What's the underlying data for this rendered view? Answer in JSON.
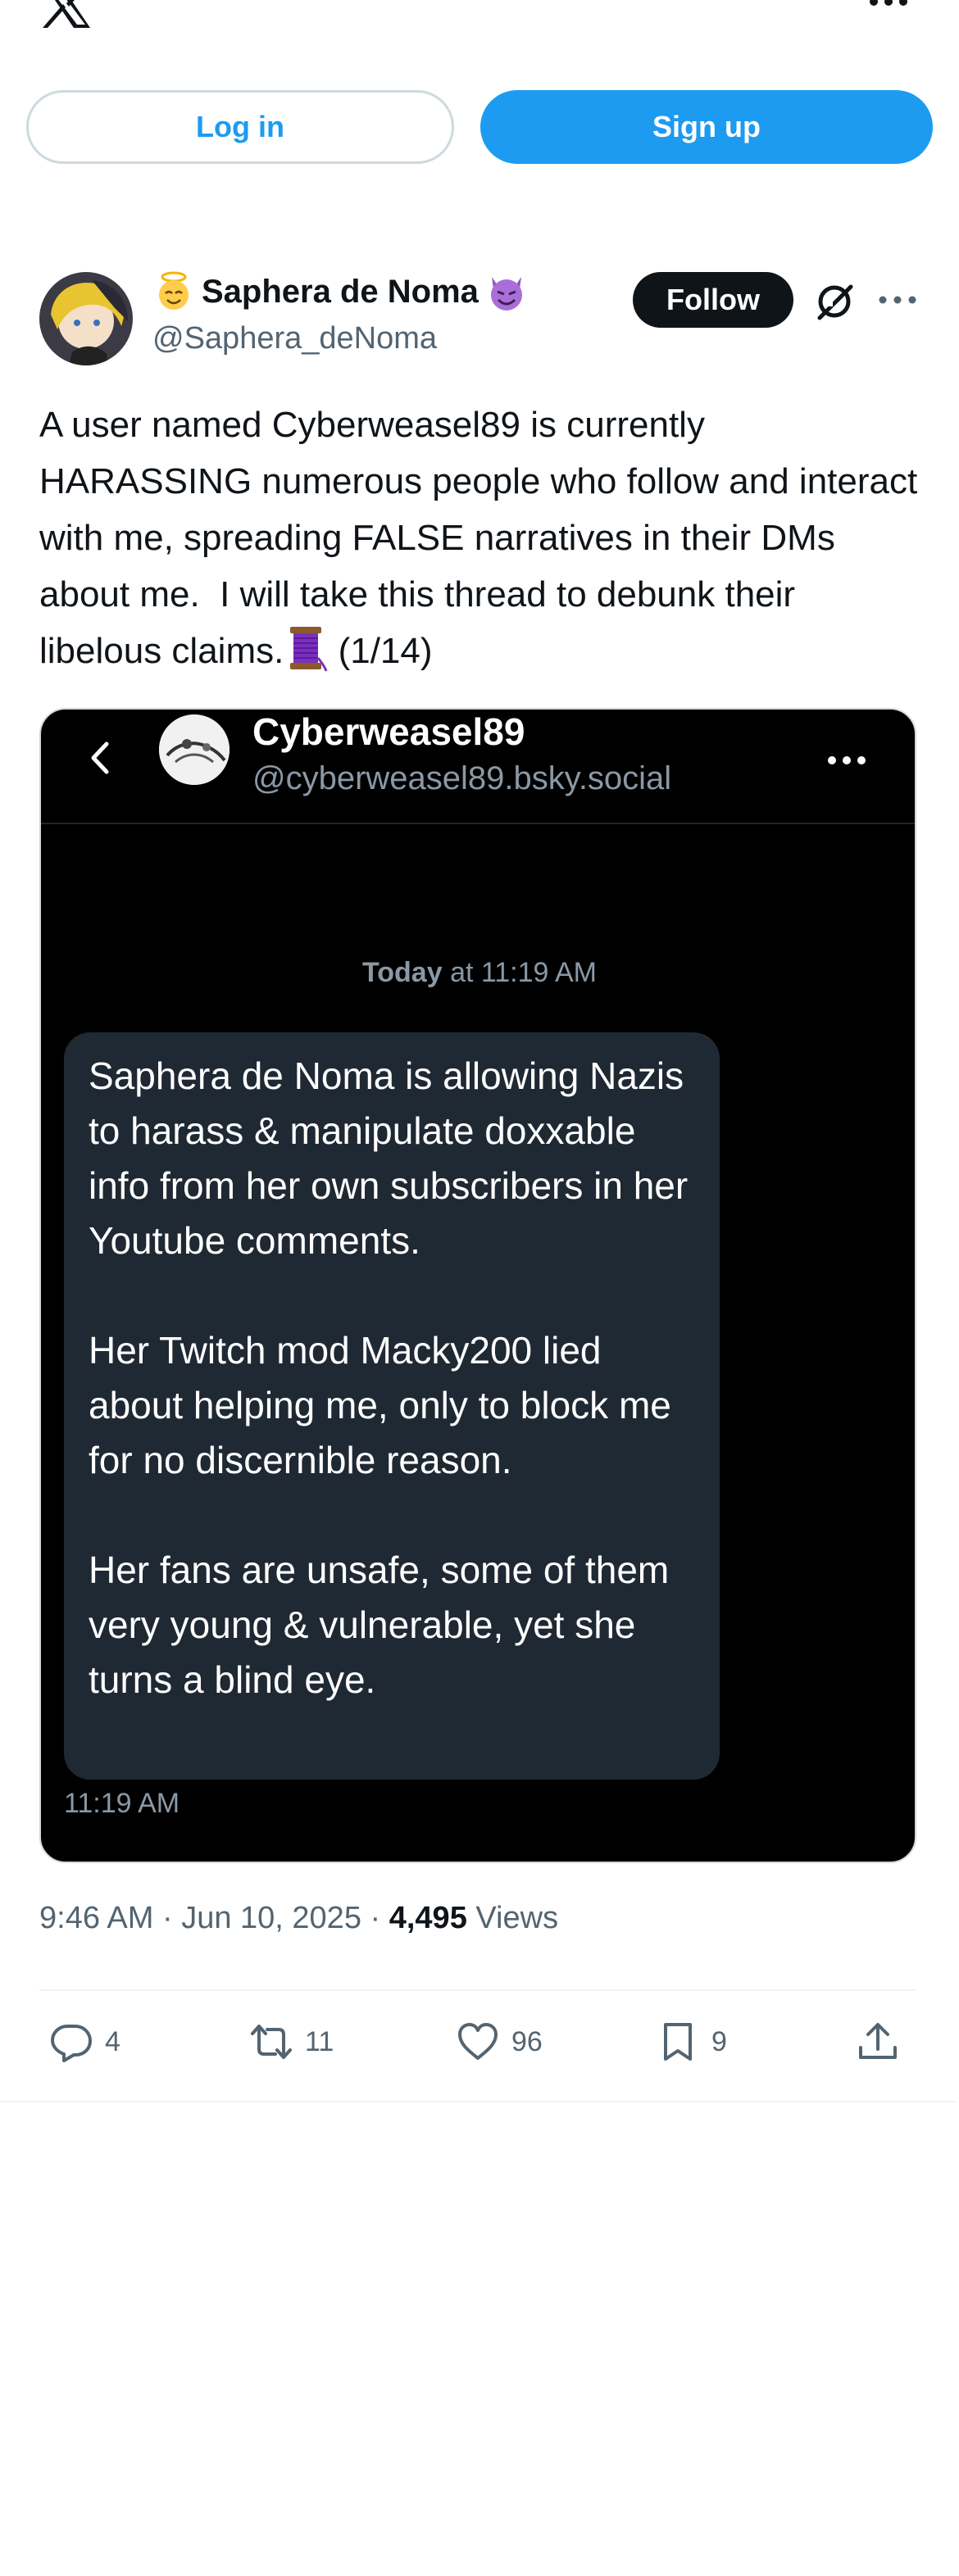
{
  "auth": {
    "login_label": "Log in",
    "signup_label": "Sign up"
  },
  "post": {
    "display_name": "Saphera de Noma",
    "handle": "@Saphera_deNoma",
    "follow_label": "Follow",
    "text": "A user named Cyberweasel89 is currently HARASSING numerous people who follow and interact with me, spreading FALSE narratives in their DMs about me.  I will take this thread to debunk their libelous claims.",
    "thread_counter": "(1/14)",
    "time": "9:46 AM",
    "date": "Jun 10, 2025",
    "views_count": "4,495",
    "views_label": "Views"
  },
  "dm": {
    "name": "Cyberweasel89",
    "handle": "@cyberweasel89.bsky.social",
    "date_day": "Today",
    "date_rest": "at 11:19 AM",
    "message": "Saphera de Noma is allowing Nazis to harass & manipulate doxxable info from her own subscribers in her Youtube comments.\n\nHer Twitch mod Macky200 lied about helping me, only to block me for no discernible reason.\n\nHer fans are unsafe, some of them very young & vulnerable, yet she turns a blind eye.",
    "message_time": "11:19 AM"
  },
  "actions": {
    "replies": "4",
    "reposts": "11",
    "likes": "96",
    "bookmarks": "9"
  },
  "colors": {
    "accent": "#1d9bf0",
    "text": "#0f1419",
    "secondary": "#536471",
    "bubble": "#1f2933"
  },
  "icons": [
    "x-logo-icon",
    "more-icon",
    "grok-icon",
    "reply-icon",
    "repost-icon",
    "like-icon",
    "bookmark-icon",
    "share-icon",
    "back-icon"
  ]
}
